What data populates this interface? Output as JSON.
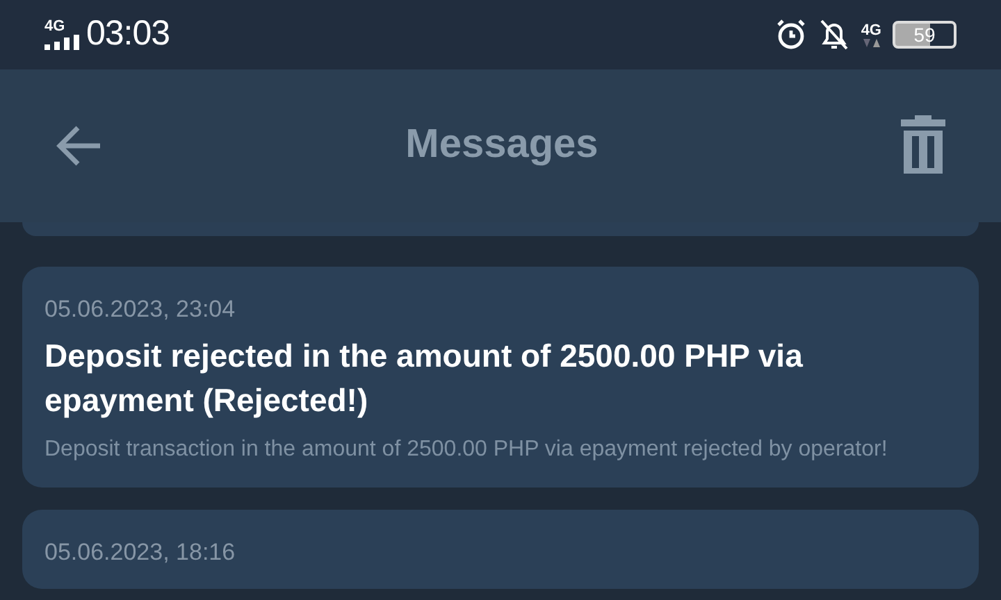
{
  "status_bar": {
    "network": "4G",
    "time": "03:03",
    "data_network": "4G",
    "battery": "59"
  },
  "header": {
    "title": "Messages"
  },
  "messages": [
    {
      "date": "05.06.2023, 23:04",
      "title": "Deposit rejected in the amount of 2500.00 PHP via epayment (Rejected!)",
      "body": "Deposit transaction in the amount of 2500.00 PHP via epayment rejected by operator!"
    },
    {
      "date": "05.06.2023, 18:16"
    }
  ]
}
